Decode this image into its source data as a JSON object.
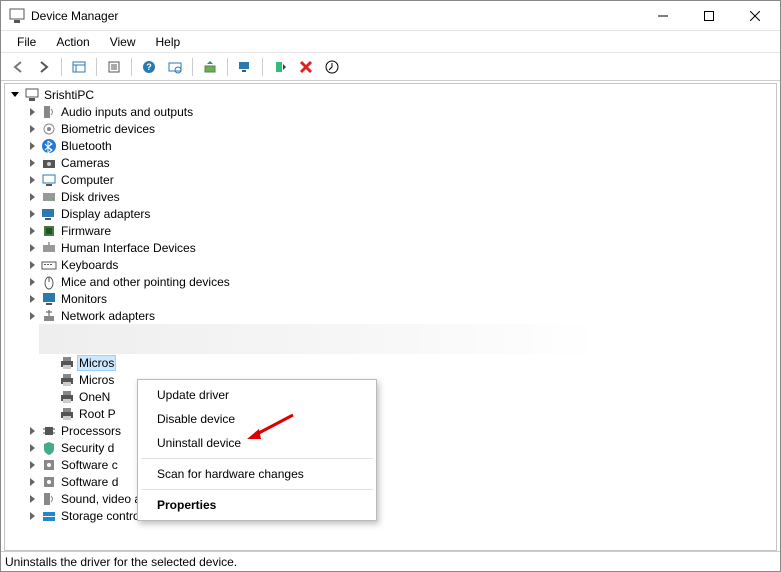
{
  "window": {
    "title": "Device Manager"
  },
  "menus": {
    "file": "File",
    "action": "Action",
    "view": "View",
    "help": "Help"
  },
  "tree": {
    "root": "SrishtiPC",
    "items": [
      "Audio inputs and outputs",
      "Biometric devices",
      "Bluetooth",
      "Cameras",
      "Computer",
      "Disk drives",
      "Display adapters",
      "Firmware",
      "Human Interface Devices",
      "Keyboards",
      "Mice and other pointing devices",
      "Monitors",
      "Network adapters"
    ],
    "subitems": [
      "Micros",
      "Micros",
      "OneN",
      "Root P"
    ],
    "tail": [
      "Processors",
      "Security d",
      "Software c",
      "Software d",
      "Sound, video and game controllers",
      "Storage controllers"
    ]
  },
  "context_menu": {
    "update": "Update driver",
    "disable": "Disable device",
    "uninstall": "Uninstall device",
    "scan": "Scan for hardware changes",
    "properties": "Properties"
  },
  "status": {
    "text": "Uninstalls the driver for the selected device."
  }
}
